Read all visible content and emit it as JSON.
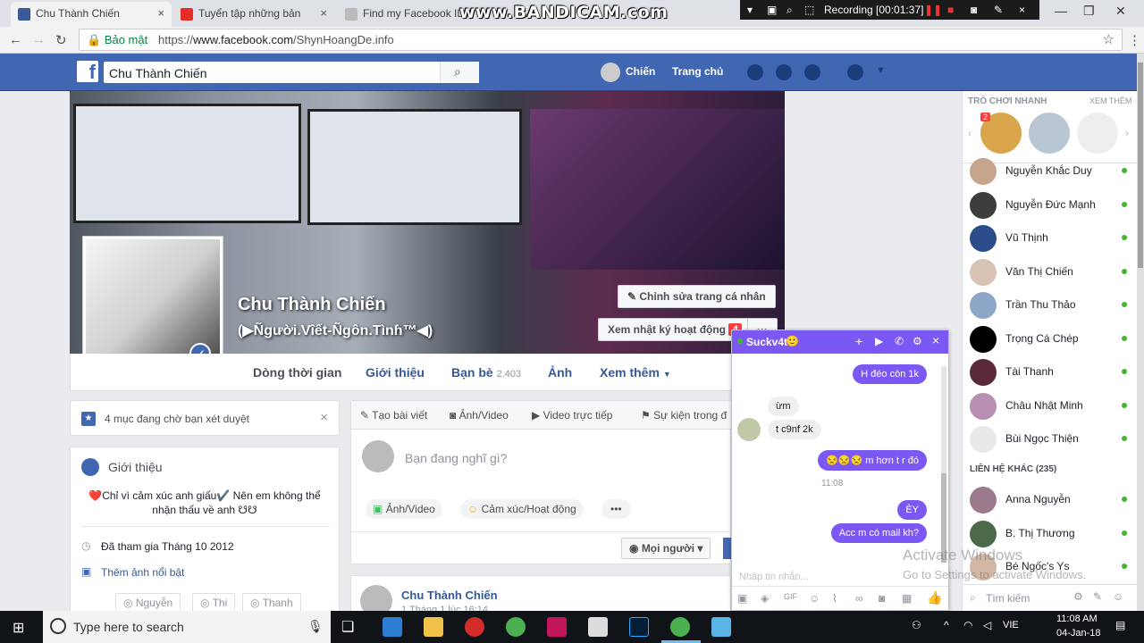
{
  "browser": {
    "tabs": [
      {
        "label": "Chu Thành Chiến",
        "icon": "facebook-icon",
        "active": true
      },
      {
        "label": "Tuyển tập những bản",
        "icon": "youtube-icon",
        "active": false
      },
      {
        "label": "Find my Facebook ID",
        "icon": "page-icon",
        "active": false
      }
    ],
    "watermark": "www.BANDICAM.com",
    "recording": "Recording [00:01:37]",
    "secure_label": "Bảo mật",
    "url_prefix": "https://",
    "url_host": "www.facebook.com",
    "url_path": "/ShynHoangDe.info"
  },
  "fb_header": {
    "search_value": "Chu Thành Chiến",
    "user_name": "Chiến",
    "home_label": "Trang chủ"
  },
  "profile": {
    "name": "Chu Thành Chiến",
    "subtitle": "(▶Ñgười.Vîết-Ñgôn.Tìnɦ™◀)",
    "edit_profile": "Chỉnh sửa trang cá nhân",
    "activity_log": "Xem nhật ký hoạt động",
    "activity_count": "4",
    "more_btn": "···",
    "nav": {
      "timeline": "Dòng thời gian",
      "about": "Giới thiệu",
      "friends": "Bạn bè",
      "friends_count": "2.403",
      "photos": "Ảnh",
      "more": "Xem thêm"
    }
  },
  "review_card": {
    "text": "4 mục đang chờ bạn xét duyệt"
  },
  "intro": {
    "title": "Giới thiệu",
    "bio": "❤️Chỉ vì cảm xúc anh giấu✔️ Nên em không thể nhận thấu về anh ☋☋",
    "joined": "Đã tham gia Tháng 10 2012",
    "add_photos": "Thêm ảnh nổi bật",
    "instagram": [
      "Nguyễn",
      "Thi",
      "Thanh"
    ]
  },
  "composer": {
    "tabs": [
      "Tạo bài viết",
      "Ảnh/Video",
      "Video trực tiếp",
      "Sự kiện trong đ"
    ],
    "placeholder": "Bạn đang nghĩ gì?",
    "photo_video": "Ảnh/Video",
    "feeling": "Cảm xúc/Hoạt động",
    "more": "•••",
    "audience": "Mọi người"
  },
  "post": {
    "author": "Chu Thành Chiến",
    "meta": "1 Tháng 1 lúc 16:14"
  },
  "sidebar": {
    "quick_games": "TRÒ CHƠI NHANH",
    "see_more": "XEM THÊM",
    "game_badge": "2",
    "friends": [
      {
        "name": "Nguyễn Khắc Duy",
        "color": "#c7a58c"
      },
      {
        "name": "Nguyễn Đức Mạnh",
        "color": "#3d3d3d"
      },
      {
        "name": "Vũ Thịnh",
        "color": "#2a4c8a"
      },
      {
        "name": "Văn Thị Chiến",
        "color": "#d8c3b5"
      },
      {
        "name": "Trần Thu Thảo",
        "color": "#8fa7c6"
      },
      {
        "name": "Trọng Cá Chép",
        "color": "#000000"
      },
      {
        "name": "Tài Thanh",
        "color": "#5a2a3a"
      },
      {
        "name": "Châu Nhật Minh",
        "color": "#b88fb2"
      },
      {
        "name": "Bùi Ngọc Thiện",
        "color": "#e8e8e8"
      }
    ],
    "other_contacts": "LIÊN HỆ KHÁC (235)",
    "other": [
      {
        "name": "Anna Nguyễn",
        "color": "#9c7a8c"
      },
      {
        "name": "B. Thị Thương",
        "color": "#4a6a4a"
      },
      {
        "name": "Bé Ngốc's Ys",
        "color": "#d2b7a5"
      }
    ],
    "search_placeholder": "Tìm kiếm"
  },
  "chat": {
    "name": "Suckv4t",
    "messages": [
      {
        "from": "me",
        "text": "H đéo còn 1k"
      },
      {
        "from": "them",
        "text": "ừm"
      },
      {
        "from": "them",
        "text": "t c9nf 2k"
      },
      {
        "from": "me",
        "text": "😒😒😒 m hơn t r đó"
      },
      {
        "from": "time",
        "text": "11:08"
      },
      {
        "from": "me",
        "text": "ÈY"
      },
      {
        "from": "me",
        "text": "Acc m có mail kh?"
      }
    ],
    "input_placeholder": "Nhập tin nhắn..."
  },
  "windows": {
    "activate_title": "Activate Windows",
    "activate_sub": "Go to Settings to activate Windows.",
    "search_placeholder": "Type here to search",
    "time": "11:08 AM",
    "date": "04-Jan-18",
    "lang": "VIE"
  },
  "colors": {
    "fb_blue": "#4267b2",
    "messenger_purple": "#7b58f3",
    "online_green": "#42b72a"
  }
}
